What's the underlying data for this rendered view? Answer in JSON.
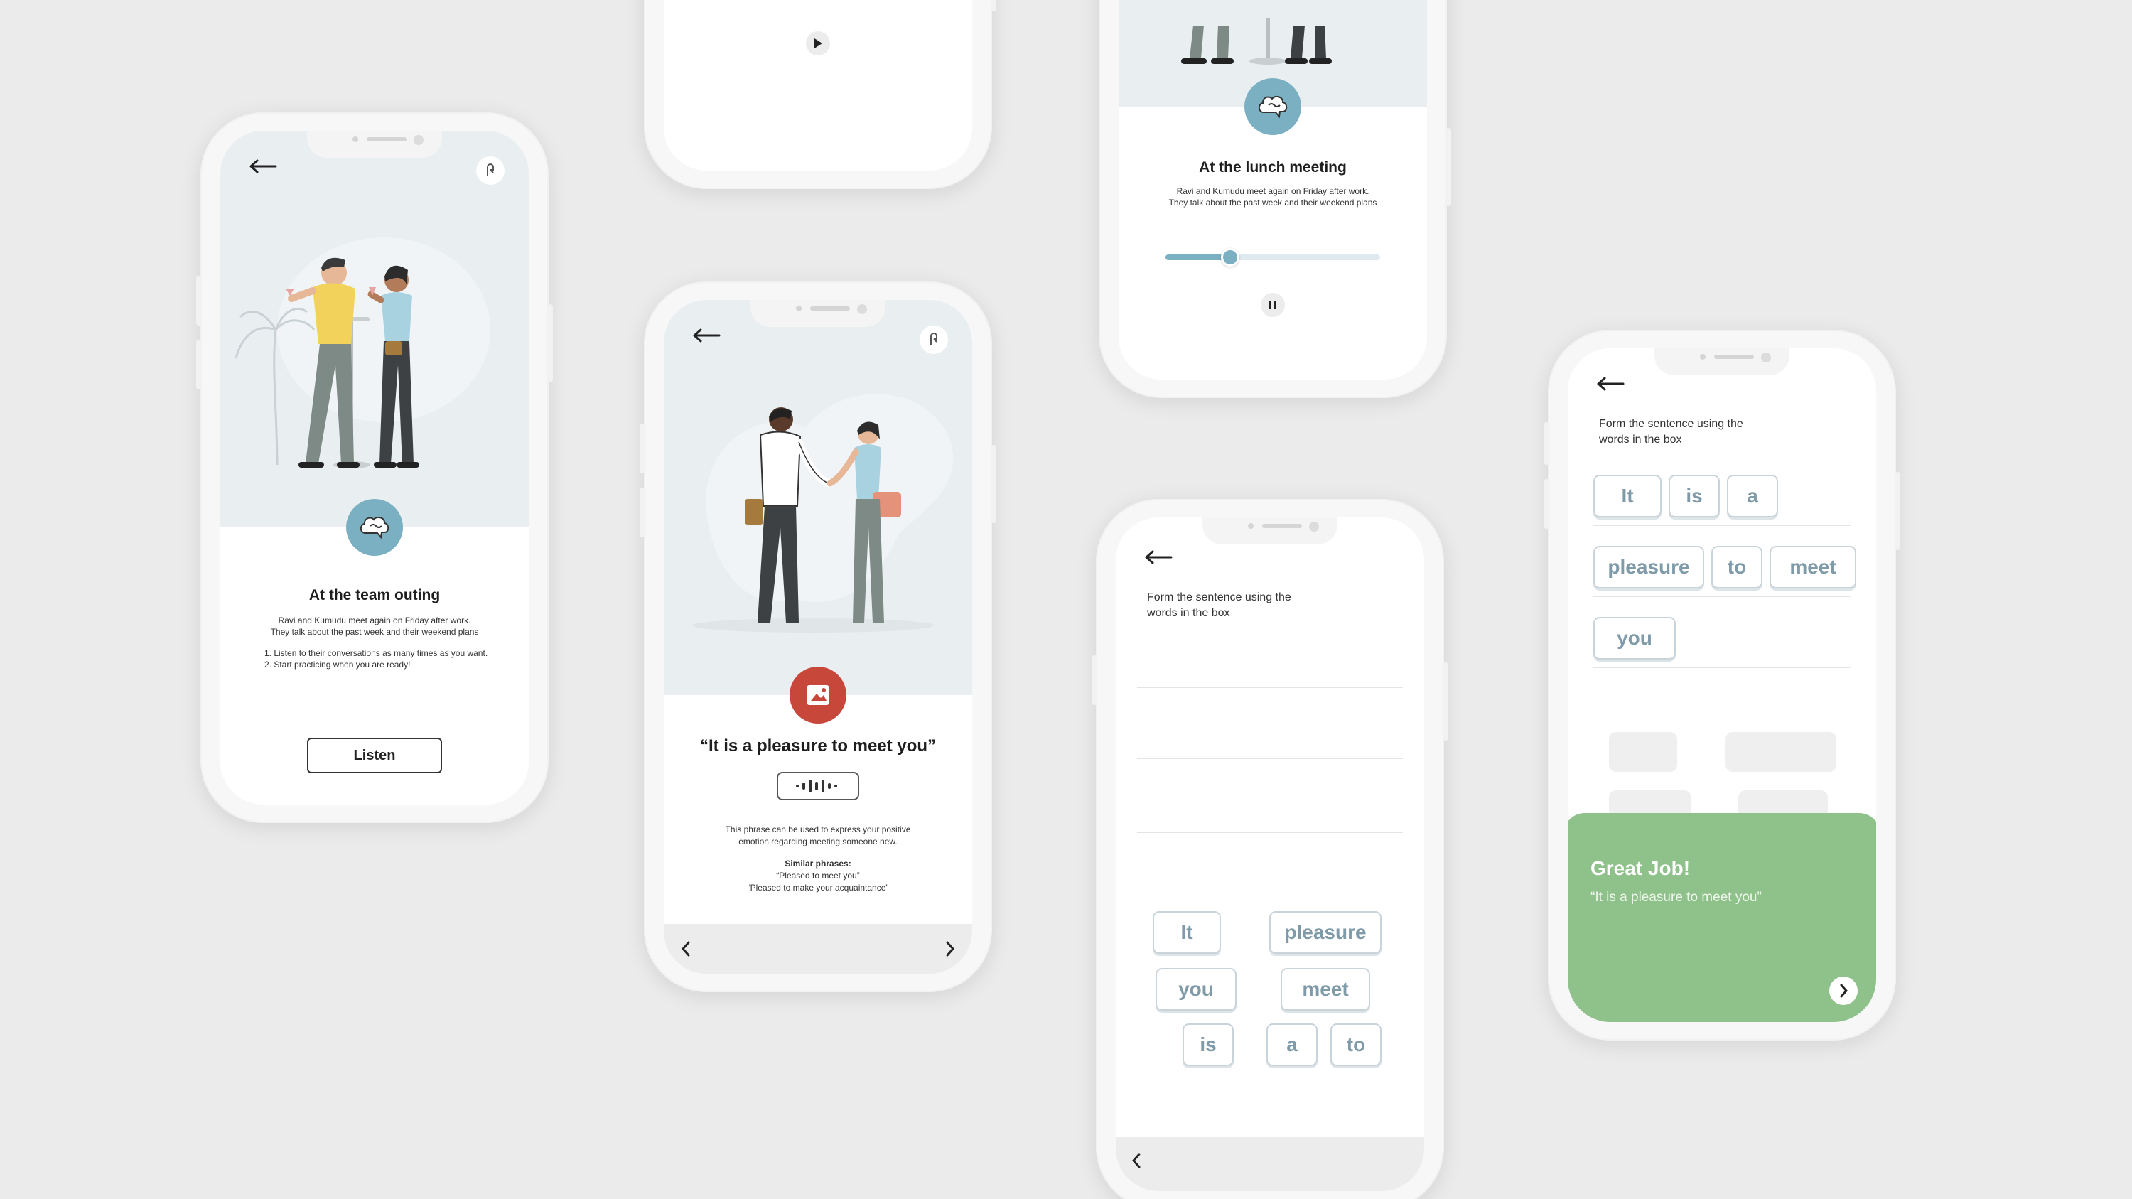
{
  "colors": {
    "background": "#ebebeb",
    "accent_blue": "#7bb0c2",
    "accent_red": "#c8473b",
    "success_green": "#8fc18a",
    "chip_text": "#7f9aa8"
  },
  "phone1": {
    "title": "At the team outing",
    "desc_line1": "Ravi and Kumudu meet again on Friday after work.",
    "desc_line2": "They talk about the past week and their weekend plans",
    "step1": "1. Listen to their conversations as many times as you want.",
    "step2": "2. Start practicing when you are ready!",
    "listen_label": "Listen"
  },
  "phone2": {
    "playback": "play"
  },
  "phone3": {
    "title": "“It is a pleasure to meet you”",
    "desc_line1": "This phrase can be used to express your positive",
    "desc_line2": "emotion regarding meeting someone new.",
    "similar_label": "Similar phrases:",
    "similar1": "“Pleased to meet you”",
    "similar2": "“Pleased to make your acquaintance”"
  },
  "phone4": {
    "title": "At the lunch meeting",
    "desc_line1": "Ravi and Kumudu meet again on Friday after work.",
    "desc_line2": "They talk about the past week and their weekend plans",
    "progress": 0.3
  },
  "phone5": {
    "instruction_line1": "Form the sentence using the",
    "instruction_line2": "words in the box",
    "words": [
      "It",
      "pleasure",
      "you",
      "meet",
      "is",
      "a",
      "to"
    ]
  },
  "phone6": {
    "instruction_line1": "Form the sentence using the",
    "instruction_line2": "words in the box",
    "answer": [
      "It",
      "is",
      "a",
      "pleasure",
      "to",
      "meet",
      "you"
    ],
    "success_title": "Great Job!",
    "success_quote": "“It is a pleasure to meet you”"
  },
  "icons": [
    "back-arrow-icon",
    "memo-icon",
    "brain-icon",
    "play-icon",
    "pause-icon",
    "chevron-left-icon",
    "chevron-right-icon",
    "audio-wave-icon",
    "photo-icon"
  ]
}
